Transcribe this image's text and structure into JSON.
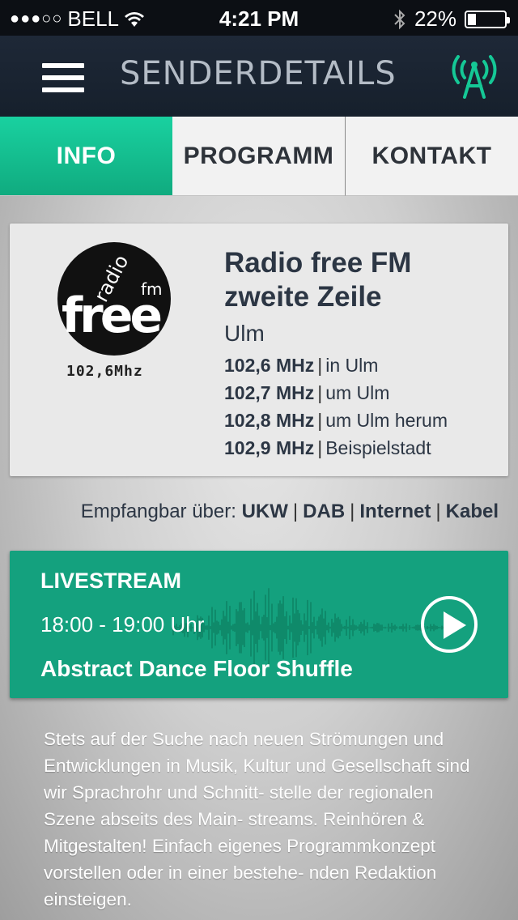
{
  "status_bar": {
    "signal_dots": "●●●○○",
    "carrier": "BELL",
    "wifi_icon": "wifi-icon",
    "time": "4:21 PM",
    "bluetooth_icon": "bluetooth-icon",
    "battery_percent": "22%",
    "battery_level": 0.22
  },
  "navbar": {
    "menu_icon": "hamburger-menu-icon",
    "title": "SENDERDETAILS",
    "antenna_icon": "radio-antenna-icon",
    "accent_color": "#15c896"
  },
  "tabs": [
    {
      "label": "INFO",
      "active": true
    },
    {
      "label": "PROGRAMM",
      "active": false
    },
    {
      "label": "KONTAKT",
      "active": false
    }
  ],
  "station": {
    "logo": {
      "word_radio": "radio",
      "word_free": "free",
      "word_fm": "fm",
      "frequency": "102,6Mhz"
    },
    "name": "Radio free FM zweite Zeile",
    "city": "Ulm",
    "frequencies": [
      {
        "freq": "102,6 MHz",
        "place": "in Ulm"
      },
      {
        "freq": "102,7 MHz",
        "place": "um Ulm"
      },
      {
        "freq": "102,8 MHz",
        "place": "um Ulm herum"
      },
      {
        "freq": "102,9 MHz",
        "place": "Beispielstadt"
      }
    ],
    "separator": "|"
  },
  "reception": {
    "label": "Empfangbar über:",
    "channels": [
      "UKW",
      "DAB",
      "Internet",
      "Kabel"
    ]
  },
  "livestream": {
    "title": "LIVESTREAM",
    "time": "18:00 - 19:00 Uhr",
    "show": "Abstract Dance Floor Shuffle",
    "play_icon": "play-icon",
    "color": "#14a17e"
  },
  "description": "Stets auf der Suche nach neuen Strömungen und Entwicklungen in Musik, Kultur und Gesellschaft sind wir Sprachrohr und Schnitt- stelle der regionalen Szene abseits des Main- streams. Reinhören & Mitgestalten! Einfach eigenes Programmkonzept vorstellen oder in einer bestehe- nden Redaktion einsteigen."
}
